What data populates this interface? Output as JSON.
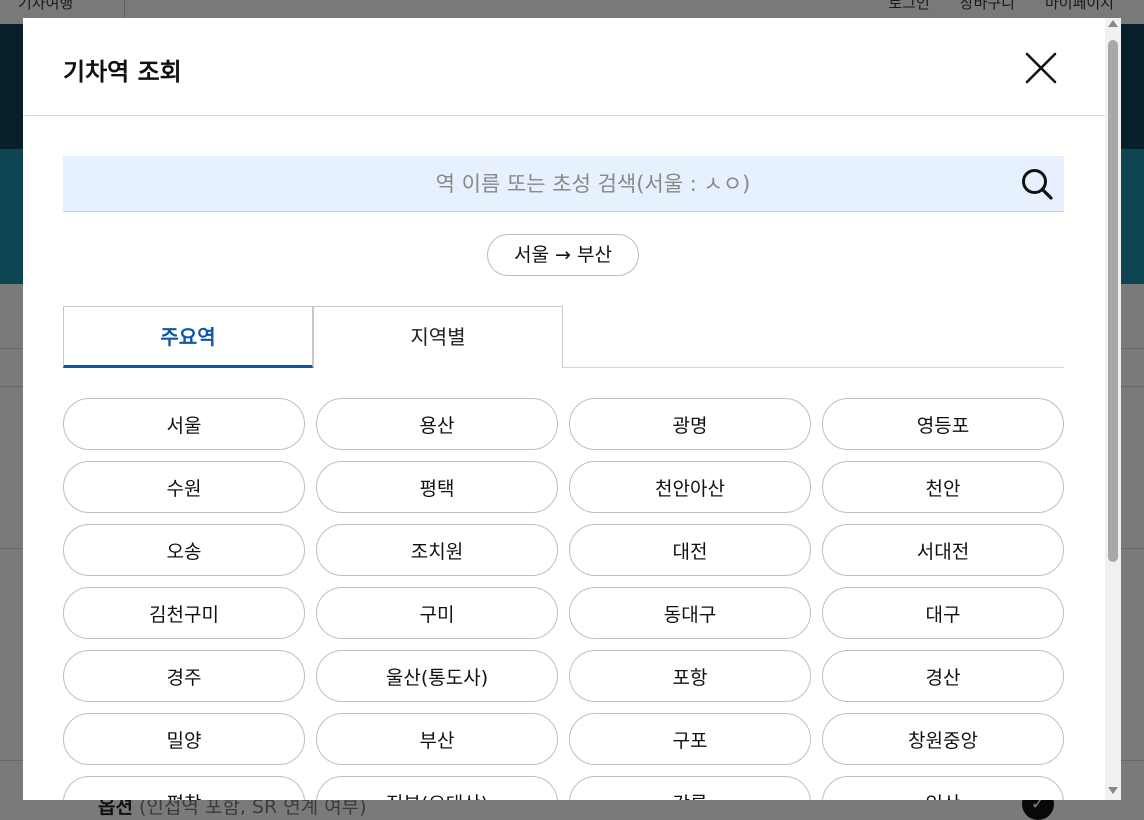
{
  "background": {
    "brand": "기차여행",
    "top_links": [
      "로그인",
      "장바구니",
      "마이페이지"
    ],
    "option": {
      "label": "옵션",
      "note": "(인접역 포함, SR 연계 여부)"
    }
  },
  "modal": {
    "title": "기차역 조회",
    "close_icon": "close-icon",
    "search": {
      "placeholder": "역 이름 또는 초성 검색(서울 : ㅅㅇ)",
      "value": "",
      "icon": "search-icon"
    },
    "route_chip": "서울 → 부산",
    "tabs": [
      {
        "label": "주요역",
        "active": true
      },
      {
        "label": "지역별",
        "active": false
      }
    ],
    "stations": [
      "서울",
      "용산",
      "광명",
      "영등포",
      "수원",
      "평택",
      "천안아산",
      "천안",
      "오송",
      "조치원",
      "대전",
      "서대전",
      "김천구미",
      "구미",
      "동대구",
      "대구",
      "경주",
      "울산(통도사)",
      "포항",
      "경산",
      "밀양",
      "부산",
      "구포",
      "창원중앙",
      "평창",
      "진부(오대산)",
      "강릉",
      "익산"
    ]
  },
  "colors": {
    "accent": "#0b57a8",
    "search_bg": "#e6f1fd",
    "hero_dark": "#0d3f52",
    "hero_teal": "#1b8aa5"
  }
}
